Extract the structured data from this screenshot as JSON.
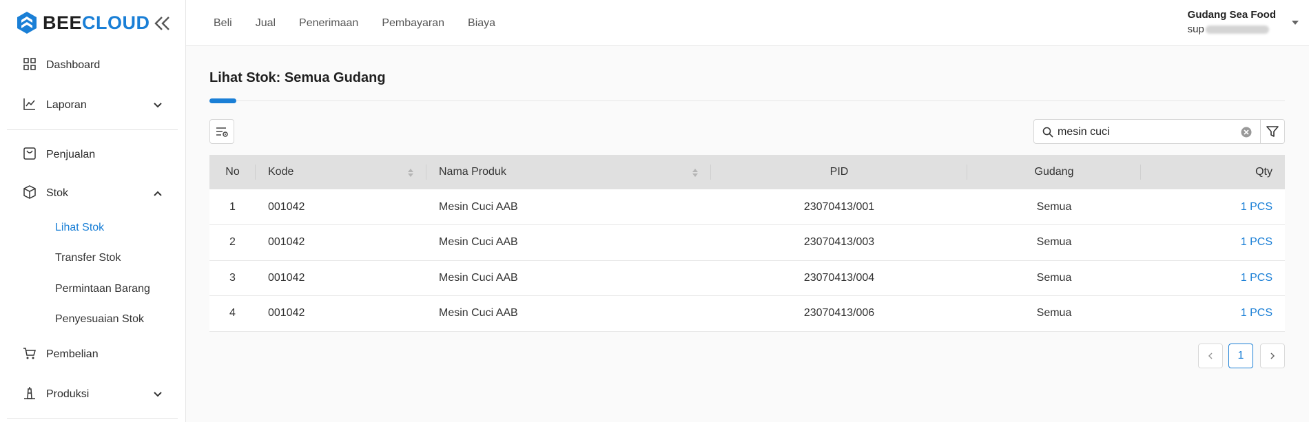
{
  "brand": {
    "part1": "BEE",
    "part2": "CLOUD"
  },
  "sidebar": {
    "items": [
      {
        "label": "Dashboard"
      },
      {
        "label": "Laporan"
      },
      {
        "label": "Penjualan"
      },
      {
        "label": "Stok"
      },
      {
        "label": "Pembelian"
      },
      {
        "label": "Produksi"
      }
    ],
    "stok_sub": [
      {
        "label": "Lihat Stok"
      },
      {
        "label": "Transfer Stok"
      },
      {
        "label": "Permintaan Barang"
      },
      {
        "label": "Penyesuaian Stok"
      }
    ]
  },
  "topnav": [
    "Beli",
    "Jual",
    "Penerimaan",
    "Pembayaran",
    "Biaya"
  ],
  "user": {
    "name": "Gudang Sea Food",
    "email_prefix": "sup"
  },
  "page": {
    "title": "Lihat Stok: Semua Gudang"
  },
  "search": {
    "value": "mesin cuci"
  },
  "table": {
    "headers": {
      "no": "No",
      "kode": "Kode",
      "nama": "Nama Produk",
      "pid": "PID",
      "gudang": "Gudang",
      "qty": "Qty"
    },
    "rows": [
      {
        "no": "1",
        "kode": "001042",
        "nama": "Mesin Cuci AAB",
        "pid": "23070413/001",
        "gudang": "Semua",
        "qty": "1 PCS"
      },
      {
        "no": "2",
        "kode": "001042",
        "nama": "Mesin Cuci AAB",
        "pid": "23070413/003",
        "gudang": "Semua",
        "qty": "1 PCS"
      },
      {
        "no": "3",
        "kode": "001042",
        "nama": "Mesin Cuci AAB",
        "pid": "23070413/004",
        "gudang": "Semua",
        "qty": "1 PCS"
      },
      {
        "no": "4",
        "kode": "001042",
        "nama": "Mesin Cuci AAB",
        "pid": "23070413/006",
        "gudang": "Semua",
        "qty": "1 PCS"
      }
    ]
  },
  "pagination": {
    "current": "1"
  },
  "colors": {
    "accent": "#1a7fd6",
    "header_bg": "#e0e0e0"
  }
}
